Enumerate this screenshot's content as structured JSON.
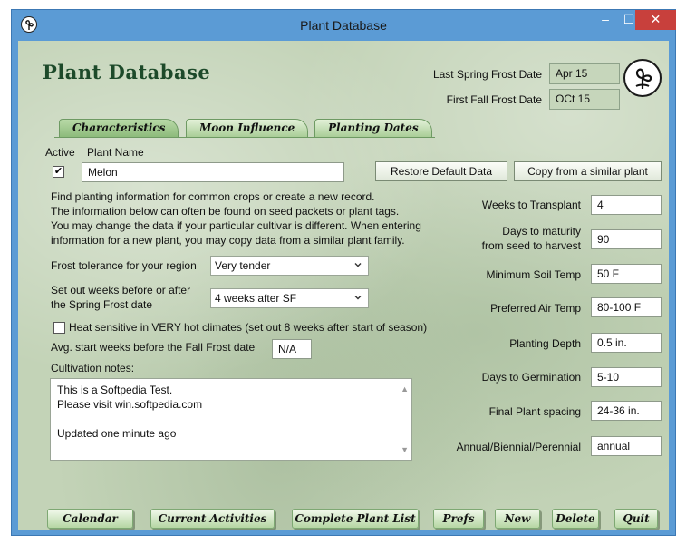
{
  "window": {
    "title": "Plant Database",
    "controls": {
      "minimize": "–",
      "maximize": "☐",
      "close": "✕"
    }
  },
  "header": {
    "brand": "Plant Database",
    "last_spring_frost_label": "Last Spring Frost Date",
    "last_spring_frost_value": "Apr 15",
    "first_fall_frost_label": "First Fall Frost Date",
    "first_fall_frost_value": "OCt 15"
  },
  "tabs": [
    {
      "label": "Characteristics",
      "active": true
    },
    {
      "label": "Moon Influence",
      "active": false
    },
    {
      "label": "Planting Dates",
      "active": false
    }
  ],
  "record": {
    "active_label": "Active",
    "active_checked": true,
    "active_mark": "✔",
    "plant_name_label": "Plant Name",
    "plant_name": "Melon"
  },
  "actions": {
    "restore_default": "Restore Default Data",
    "copy_similar": "Copy from a similar plant"
  },
  "info_lines": [
    "Find planting information for common crops or create a new record.",
    "The information below can often be found on seed packets or plant tags.",
    "You may change the data if your particular cultivar is different. When entering",
    "information for a new plant, you may copy data from a similar plant family."
  ],
  "frost_tolerance": {
    "label": "Frost tolerance for your region",
    "value": "Very tender"
  },
  "set_out": {
    "label_line1": "Set out weeks before or after",
    "label_line2": "the Spring Frost date",
    "value": "4 weeks after SF"
  },
  "heat_sensitive": {
    "label": "Heat sensitive in VERY hot climates (set out 8 weeks after start of season)",
    "checked": false
  },
  "avg_start": {
    "label": "Avg. start weeks before the Fall Frost date",
    "value": "N/A"
  },
  "cultivation": {
    "label": "Cultivation notes:",
    "lines": [
      "This is a Softpedia Test.",
      "Please visit win.softpedia.com",
      "",
      "Updated one minute ago"
    ]
  },
  "fields": {
    "weeks_to_transplant": {
      "label": "Weeks to Transplant",
      "value": "4"
    },
    "days_to_maturity": {
      "label_line1": "Days to maturity",
      "label_line2": "from seed to harvest",
      "value": "90"
    },
    "min_soil_temp": {
      "label": "Minimum Soil Temp",
      "value": "50 F"
    },
    "pref_air_temp": {
      "label": "Preferred Air Temp",
      "value": "80-100 F"
    },
    "planting_depth": {
      "label": "Planting Depth",
      "value": "0.5 in."
    },
    "days_to_germination": {
      "label": "Days to Germination",
      "value": "5-10"
    },
    "final_spacing": {
      "label": "Final Plant spacing",
      "value": "24-36 in."
    },
    "life_cycle": {
      "label": "Annual/Biennial/Perennial",
      "value": "annual"
    }
  },
  "bottom_buttons": {
    "calendar": "Calendar",
    "current_activities": "Current Activities",
    "complete_list": "Complete Plant List",
    "prefs": "Prefs",
    "new": "New",
    "delete": "Delete",
    "quit": "Quit"
  },
  "icons": {
    "app": "plant-sprout-icon",
    "logo": "plant-sprout-logo",
    "dropdown": "chevron-down-icon"
  },
  "colors": {
    "titlebar": "#5b9bd5",
    "close": "#c8403c",
    "background": "#c3d3b7",
    "tab": "#a9cd97",
    "brand_text": "#1d4a2a"
  }
}
